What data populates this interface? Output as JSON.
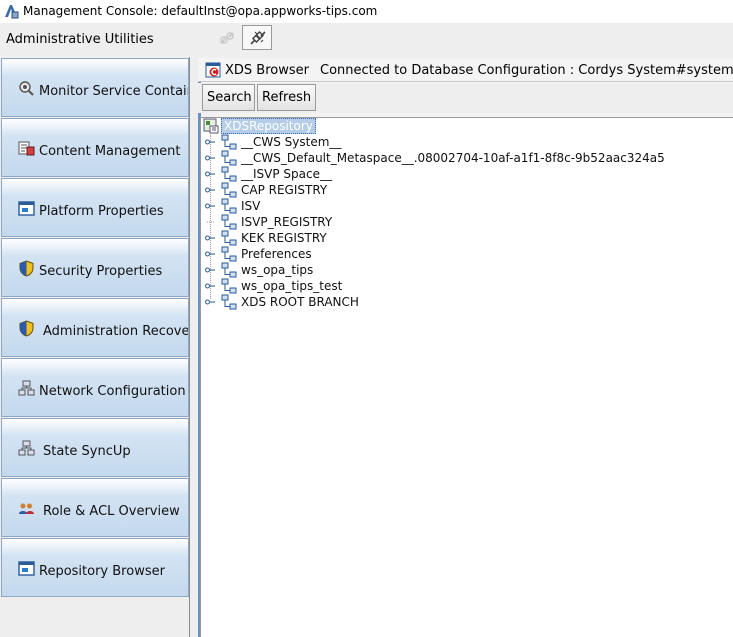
{
  "window": {
    "title": "Management Console: defaultInst@opa.appworks-tips.com",
    "icon": "management-console-icon"
  },
  "utilities": {
    "title": "Administrative Utilities",
    "toolbar_icons": [
      "disconnect-icon",
      "connect-icon"
    ]
  },
  "sidebar": {
    "items": [
      {
        "label": "Monitor Service Container",
        "icon": "gear-search-icon"
      },
      {
        "label": "Content Management",
        "icon": "content-management-icon"
      },
      {
        "label": "Platform Properties",
        "icon": "platform-properties-icon"
      },
      {
        "label": "Security Properties",
        "icon": "shield-icon"
      },
      {
        "label": "Administration Recovery",
        "icon": "shield-icon"
      },
      {
        "label": "Network Configuration",
        "icon": "network-icon"
      },
      {
        "label": "State SyncUp",
        "icon": "network-icon"
      },
      {
        "label": "Role & ACL Overview",
        "icon": "users-icon"
      },
      {
        "label": "Repository Browser",
        "icon": "repository-icon"
      }
    ]
  },
  "xds": {
    "tab_title": "XDS Browser",
    "status": "Connected to Database Configuration : Cordys System#system",
    "search_label": "Search",
    "refresh_label": "Refresh",
    "tree": {
      "root": "XDSRepository",
      "nodes": [
        {
          "label": "__CWS System__",
          "expandable": true
        },
        {
          "label": "__CWS_Default_Metaspace__.08002704-10af-a1f1-8f8c-9b52aac324a5",
          "expandable": true
        },
        {
          "label": "__ISVP Space__",
          "expandable": true
        },
        {
          "label": "CAP REGISTRY",
          "expandable": true
        },
        {
          "label": "ISV",
          "expandable": true
        },
        {
          "label": "ISVP_REGISTRY",
          "expandable": false
        },
        {
          "label": "KEK REGISTRY",
          "expandable": true
        },
        {
          "label": "Preferences",
          "expandable": true
        },
        {
          "label": "ws_opa_tips",
          "expandable": true
        },
        {
          "label": "ws_opa_tips_test",
          "expandable": true
        },
        {
          "label": "XDS ROOT BRANCH",
          "expandable": true
        }
      ]
    }
  },
  "colors": {
    "accent": "#6a8fc0",
    "nav_button": "#c4d9ee",
    "selection": "#b5cde6"
  }
}
